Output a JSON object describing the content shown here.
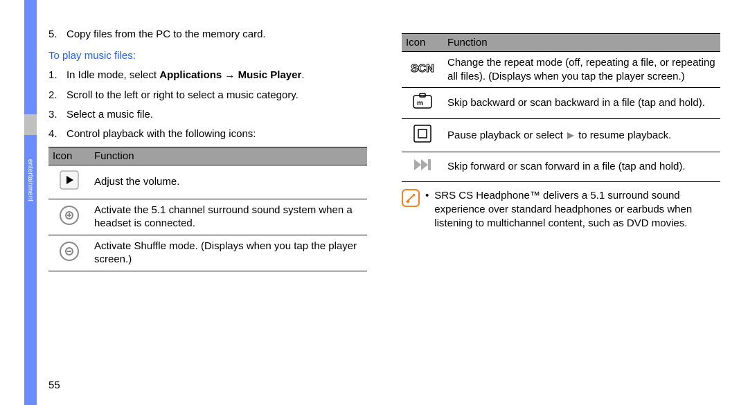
{
  "side_label": "entertainment",
  "page_number": "55",
  "left": {
    "pre_step_num": "5.",
    "pre_step_text": "Copy files from the PC to the memory card.",
    "heading": "To play music files:",
    "steps": [
      {
        "num": "1.",
        "prefix": "In Idle mode, select ",
        "bold1": "Applications",
        "arrow": " → ",
        "bold2": "Music Player",
        "suffix": "."
      },
      {
        "num": "2.",
        "text": "Scroll to the left or right to select a music category."
      },
      {
        "num": "3.",
        "text": "Select a music file."
      },
      {
        "num": "4.",
        "text": "Control playback with the following icons:"
      }
    ],
    "table": {
      "h_icon": "Icon",
      "h_func": "Function",
      "rows": [
        {
          "func": "Adjust the volume."
        },
        {
          "func": "Activate the 5.1 channel surround sound system when a headset is connected."
        },
        {
          "func": "Activate Shuffle mode. (Displays when you tap the player screen.)"
        }
      ]
    }
  },
  "right": {
    "table": {
      "h_icon": "Icon",
      "h_func": "Function",
      "rows": [
        {
          "func": "Change the repeat mode (off, repeating a file, or repeating all files). (Displays when you tap the player screen.)"
        },
        {
          "func": "Skip backward or scan backward in a file (tap and hold)."
        },
        {
          "func_pre": "Pause playback or select ",
          "func_post": " to resume playback."
        },
        {
          "func": "Skip forward or scan forward in a file (tap and hold)."
        }
      ]
    },
    "note": "SRS CS Headphone™ delivers a 5.1 surround sound experience over standard headphones or earbuds when listening to multichannel content, such as DVD movies."
  }
}
